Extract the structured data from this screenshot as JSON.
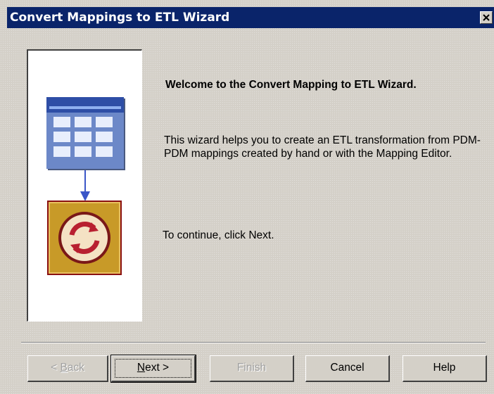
{
  "window": {
    "title": "Convert Mappings to ETL Wizard"
  },
  "content": {
    "heading": "Welcome to the Convert Mapping to ETL Wizard.",
    "description": "This wizard helps you to create an ETL transformation from PDM-PDM mappings created by hand or with the Mapping Editor.",
    "continue_text": "To continue, click Next."
  },
  "buttons": {
    "back": {
      "prefix": "< ",
      "mnemonic": "B",
      "rest": "ack",
      "enabled": false
    },
    "next": {
      "mnemonic": "N",
      "rest": "ext >",
      "enabled": true,
      "default": true
    },
    "finish": {
      "label": "Finish",
      "enabled": false
    },
    "cancel": {
      "label": "Cancel",
      "enabled": true
    },
    "help": {
      "label": "Help",
      "enabled": true
    }
  },
  "illustration": {
    "icons": [
      "table-icon",
      "arrow-down-icon",
      "transform-icon"
    ],
    "colors": {
      "table_header": "#2e4ea6",
      "table_body": "#6c88c8",
      "cell": "#e8eefc",
      "arrow": "#3a56c8",
      "transform_box": "#c89a28",
      "transform_border": "#8a1010",
      "transform_circle": "#f4e2c4",
      "transform_arrows": "#b82030"
    }
  }
}
